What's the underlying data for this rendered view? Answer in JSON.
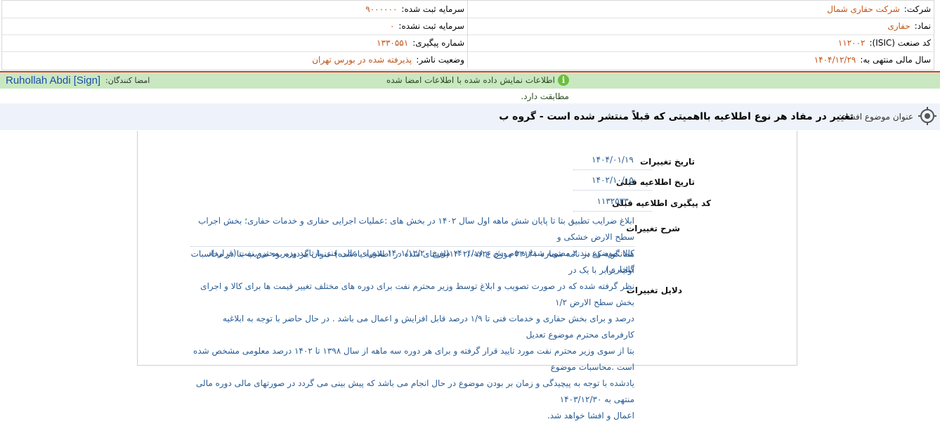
{
  "info": {
    "company_label": "شرکت:",
    "company_value": "شرکت حفاری شمال",
    "capital_registered_label": "سرمایه ثبت شده:",
    "capital_registered_value": "۹۰۰۰۰۰۰",
    "symbol_label": "نماد:",
    "symbol_value": "حفاری",
    "capital_unregistered_label": "سرمایه ثبت نشده:",
    "capital_unregistered_value": "۰",
    "isic_label": "کد صنعت (ISIC):",
    "isic_value": "۱۱۲۰۰۲",
    "tracking_label": "شماره پیگیری:",
    "tracking_value": "۱۳۳۰۵۵۱",
    "fiscal_label": "سال مالی منتهی به:",
    "fiscal_value": "۱۴۰۴/۱۲/۲۹",
    "publisher_status_label": "وضعیت ناشر:",
    "publisher_status_value": "پذیرفته شده در بورس تهران"
  },
  "verification": {
    "message": "اطلاعات نمایش داده شده با اطلاعات امضا شده مطابقت دارد.",
    "icon_glyph": "i",
    "signers_label": "امضا کنندگان:",
    "signers_name": "Ruhollah Abdi [Sign]"
  },
  "title": {
    "label": "عنوان موضوع افشاء:",
    "text": "تغییر در مفاد هر نوع اطلاعیه بااهمیتی که قبلاً منتشر شده است - گروه ب"
  },
  "fields": {
    "change_date_label": "تاریخ تغییرات",
    "change_date_value": "۱۴۰۴/۰۱/۱۹",
    "prev_date_label": "تاریخ اطلاعیه قبلی",
    "prev_date_value": "۱۴۰۲/۱۰/۰۵",
    "prev_code_label": "کد پیگیری اطلاعیه قبلی",
    "prev_code_value": "۱۱۳۲۵۳۳",
    "desc_label": "شرح تغییرات",
    "desc_lines": [
      "ابلاغ ضرایب تطبیق بتا تا پایان شش ماهه اول سال ۱۴۰۲ در بخش های :عملیات اجرایی حفاری و خدمات حفاری؛ بخش اجراب سطح الارض خشکی و",
      "کالا :موضوع بند ۲ مصوبه شماره ۵م -ش ع ف/۱۴۰۱ مورخ ۱۴۰۱/۱۲/۲۰ شورای عالی فنی با تایید وزیر محترم نفت (قرارداد گلخاری)"
    ],
    "reasons_label": "دلایل تغییرات",
    "reasons_lines": [
      "همانگونه که در نامه شماره ۳۳۱۲۱ مورخ ۱۴۰۲/۰۷/۲۶(افشای شده در اطلاعیه یادشده) عنوان گردیده بود ضریب بتا در محاسبات اولیه برابر با یک در",
      "نظر گرفته شده که در صورت تصویب و ابلاغ توسط وزیر محترم نفت برای دوره های مختلف تغییر قیمت ها برای کالا و اجرای بخش سطح الارض ۱/۲",
      "درصد و برای بخش حفاری و خدمات فنی تا ۱/۹ درصد قابل افزایش و اعمال می باشد . در حال حاضر با توجه به ابلاغیه کارفرمای محترم موضوع تعدیل",
      "بتا از سوی وزیر محترم نفت مورد تایید قرار گرفته و برای هر دوره سه ماهه از سال ۱۳۹۸ تا ۱۴۰۲ درصد معلومی مشخص شده است .محاسبات موضوع",
      "یادشده با توجه به پیچیدگی و زمان بر بودن موضوع در حال انجام می باشد که پیش بینی می گردد در صورتهای مالی دوره مالی منتهی به ۱۴۰۳/۱۲/۳۰",
      "اعمال و افشا خواهد شد."
    ]
  }
}
